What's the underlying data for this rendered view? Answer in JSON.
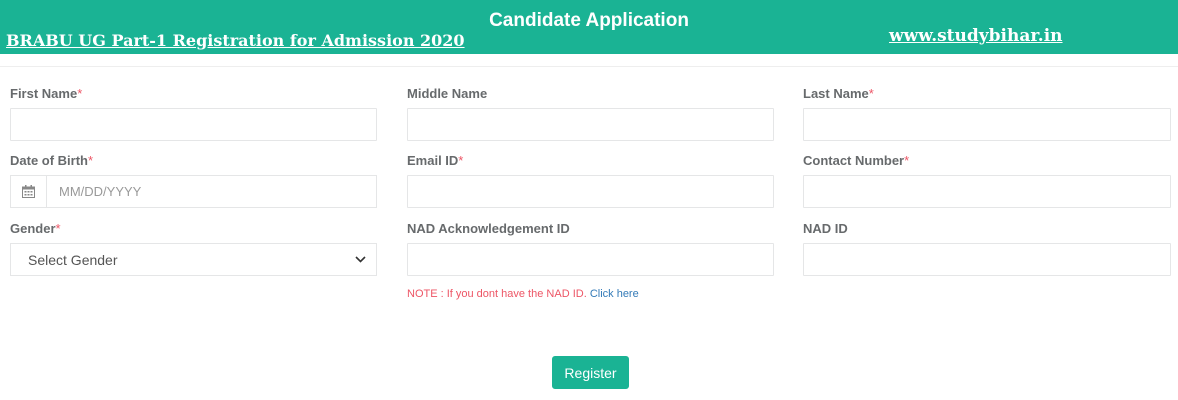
{
  "header": {
    "title": "Candidate Application",
    "left_link": "BRABU UG Part-1 Registration for Admission 2020",
    "right_link": "www.studybihar.in"
  },
  "form": {
    "required_marker": "*",
    "first_name": {
      "label": "First Name",
      "value": ""
    },
    "middle_name": {
      "label": "Middle Name",
      "value": ""
    },
    "last_name": {
      "label": "Last Name",
      "value": ""
    },
    "dob": {
      "label": "Date of Birth",
      "placeholder": "MM/DD/YYYY",
      "value": ""
    },
    "email": {
      "label": "Email ID",
      "value": ""
    },
    "contact": {
      "label": "Contact Number",
      "value": ""
    },
    "gender": {
      "label": "Gender",
      "selected": "Select Gender"
    },
    "nad_ack": {
      "label": "NAD Acknowledgement ID",
      "value": ""
    },
    "nad_id": {
      "label": "NAD ID",
      "value": ""
    },
    "note_text": "NOTE : If you dont have the NAD ID.",
    "note_link": "Click here",
    "register_label": "Register"
  },
  "icons": {
    "calendar": "calendar-icon",
    "dropdown": "chevron-down-icon"
  },
  "colors": {
    "accent": "#1ab394",
    "required": "#ed5565",
    "link": "#337ab7"
  }
}
